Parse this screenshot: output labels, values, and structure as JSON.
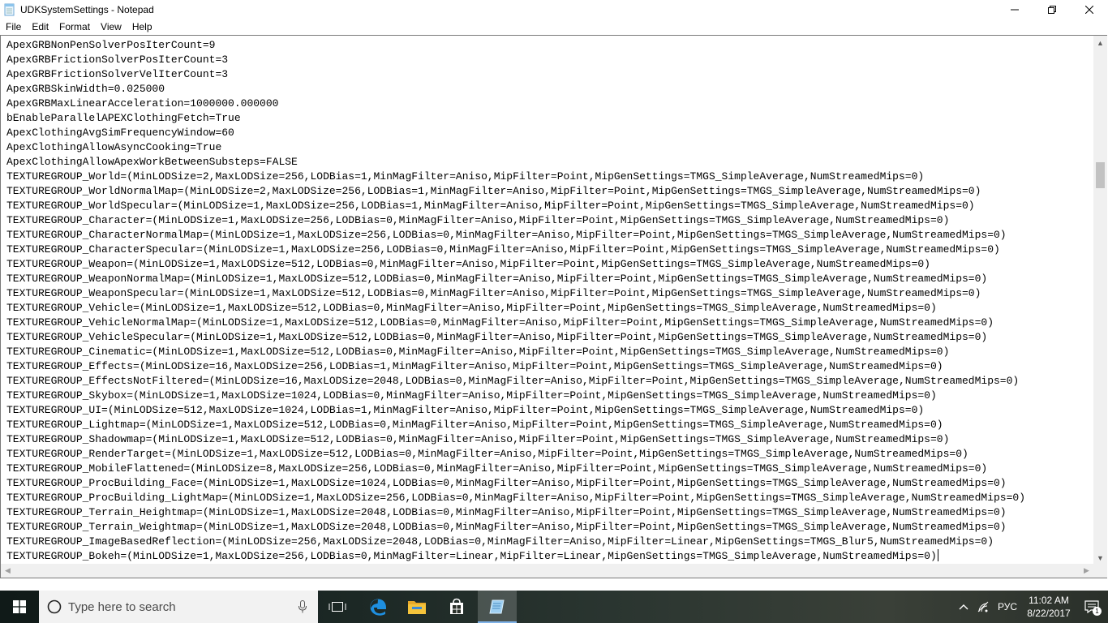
{
  "window": {
    "title": "UDKSystemSettings - Notepad"
  },
  "menu": [
    "File",
    "Edit",
    "Format",
    "View",
    "Help"
  ],
  "editor": {
    "lines": [
      "ApexGRBNonPenSolverPosIterCount=9",
      "ApexGRBFrictionSolverPosIterCount=3",
      "ApexGRBFrictionSolverVelIterCount=3",
      "ApexGRBSkinWidth=0.025000",
      "ApexGRBMaxLinearAcceleration=1000000.000000",
      "bEnableParallelAPEXClothingFetch=True",
      "ApexClothingAvgSimFrequencyWindow=60",
      "ApexClothingAllowAsyncCooking=True",
      "ApexClothingAllowApexWorkBetweenSubsteps=FALSE",
      "TEXTUREGROUP_World=(MinLODSize=2,MaxLODSize=256,LODBias=1,MinMagFilter=Aniso,MipFilter=Point,MipGenSettings=TMGS_SimpleAverage,NumStreamedMips=0)",
      "TEXTUREGROUP_WorldNormalMap=(MinLODSize=2,MaxLODSize=256,LODBias=1,MinMagFilter=Aniso,MipFilter=Point,MipGenSettings=TMGS_SimpleAverage,NumStreamedMips=0)",
      "TEXTUREGROUP_WorldSpecular=(MinLODSize=1,MaxLODSize=256,LODBias=1,MinMagFilter=Aniso,MipFilter=Point,MipGenSettings=TMGS_SimpleAverage,NumStreamedMips=0)",
      "TEXTUREGROUP_Character=(MinLODSize=1,MaxLODSize=256,LODBias=0,MinMagFilter=Aniso,MipFilter=Point,MipGenSettings=TMGS_SimpleAverage,NumStreamedMips=0)",
      "TEXTUREGROUP_CharacterNormalMap=(MinLODSize=1,MaxLODSize=256,LODBias=0,MinMagFilter=Aniso,MipFilter=Point,MipGenSettings=TMGS_SimpleAverage,NumStreamedMips=0)",
      "TEXTUREGROUP_CharacterSpecular=(MinLODSize=1,MaxLODSize=256,LODBias=0,MinMagFilter=Aniso,MipFilter=Point,MipGenSettings=TMGS_SimpleAverage,NumStreamedMips=0)",
      "TEXTUREGROUP_Weapon=(MinLODSize=1,MaxLODSize=512,LODBias=0,MinMagFilter=Aniso,MipFilter=Point,MipGenSettings=TMGS_SimpleAverage,NumStreamedMips=0)",
      "TEXTUREGROUP_WeaponNormalMap=(MinLODSize=1,MaxLODSize=512,LODBias=0,MinMagFilter=Aniso,MipFilter=Point,MipGenSettings=TMGS_SimpleAverage,NumStreamedMips=0)",
      "TEXTUREGROUP_WeaponSpecular=(MinLODSize=1,MaxLODSize=512,LODBias=0,MinMagFilter=Aniso,MipFilter=Point,MipGenSettings=TMGS_SimpleAverage,NumStreamedMips=0)",
      "TEXTUREGROUP_Vehicle=(MinLODSize=1,MaxLODSize=512,LODBias=0,MinMagFilter=Aniso,MipFilter=Point,MipGenSettings=TMGS_SimpleAverage,NumStreamedMips=0)",
      "TEXTUREGROUP_VehicleNormalMap=(MinLODSize=1,MaxLODSize=512,LODBias=0,MinMagFilter=Aniso,MipFilter=Point,MipGenSettings=TMGS_SimpleAverage,NumStreamedMips=0)",
      "TEXTUREGROUP_VehicleSpecular=(MinLODSize=1,MaxLODSize=512,LODBias=0,MinMagFilter=Aniso,MipFilter=Point,MipGenSettings=TMGS_SimpleAverage,NumStreamedMips=0)",
      "TEXTUREGROUP_Cinematic=(MinLODSize=1,MaxLODSize=512,LODBias=0,MinMagFilter=Aniso,MipFilter=Point,MipGenSettings=TMGS_SimpleAverage,NumStreamedMips=0)",
      "TEXTUREGROUP_Effects=(MinLODSize=16,MaxLODSize=256,LODBias=1,MinMagFilter=Aniso,MipFilter=Point,MipGenSettings=TMGS_SimpleAverage,NumStreamedMips=0)",
      "TEXTUREGROUP_EffectsNotFiltered=(MinLODSize=16,MaxLODSize=2048,LODBias=0,MinMagFilter=Aniso,MipFilter=Point,MipGenSettings=TMGS_SimpleAverage,NumStreamedMips=0)",
      "TEXTUREGROUP_Skybox=(MinLODSize=1,MaxLODSize=1024,LODBias=0,MinMagFilter=Aniso,MipFilter=Point,MipGenSettings=TMGS_SimpleAverage,NumStreamedMips=0)",
      "TEXTUREGROUP_UI=(MinLODSize=512,MaxLODSize=1024,LODBias=1,MinMagFilter=Aniso,MipFilter=Point,MipGenSettings=TMGS_SimpleAverage,NumStreamedMips=0)",
      "TEXTUREGROUP_Lightmap=(MinLODSize=1,MaxLODSize=512,LODBias=0,MinMagFilter=Aniso,MipFilter=Point,MipGenSettings=TMGS_SimpleAverage,NumStreamedMips=0)",
      "TEXTUREGROUP_Shadowmap=(MinLODSize=1,MaxLODSize=512,LODBias=0,MinMagFilter=Aniso,MipFilter=Point,MipGenSettings=TMGS_SimpleAverage,NumStreamedMips=0)",
      "TEXTUREGROUP_RenderTarget=(MinLODSize=1,MaxLODSize=512,LODBias=0,MinMagFilter=Aniso,MipFilter=Point,MipGenSettings=TMGS_SimpleAverage,NumStreamedMips=0)",
      "TEXTUREGROUP_MobileFlattened=(MinLODSize=8,MaxLODSize=256,LODBias=0,MinMagFilter=Aniso,MipFilter=Point,MipGenSettings=TMGS_SimpleAverage,NumStreamedMips=0)",
      "TEXTUREGROUP_ProcBuilding_Face=(MinLODSize=1,MaxLODSize=1024,LODBias=0,MinMagFilter=Aniso,MipFilter=Point,MipGenSettings=TMGS_SimpleAverage,NumStreamedMips=0)",
      "TEXTUREGROUP_ProcBuilding_LightMap=(MinLODSize=1,MaxLODSize=256,LODBias=0,MinMagFilter=Aniso,MipFilter=Point,MipGenSettings=TMGS_SimpleAverage,NumStreamedMips=0)",
      "TEXTUREGROUP_Terrain_Heightmap=(MinLODSize=1,MaxLODSize=2048,LODBias=0,MinMagFilter=Aniso,MipFilter=Point,MipGenSettings=TMGS_SimpleAverage,NumStreamedMips=0)",
      "TEXTUREGROUP_Terrain_Weightmap=(MinLODSize=1,MaxLODSize=2048,LODBias=0,MinMagFilter=Aniso,MipFilter=Point,MipGenSettings=TMGS_SimpleAverage,NumStreamedMips=0)",
      "TEXTUREGROUP_ImageBasedReflection=(MinLODSize=256,MaxLODSize=2048,LODBias=0,MinMagFilter=Aniso,MipFilter=Linear,MipGenSettings=TMGS_Blur5,NumStreamedMips=0)",
      "TEXTUREGROUP_Bokeh=(MinLODSize=1,MaxLODSize=256,LODBias=0,MinMagFilter=Linear,MipFilter=Linear,MipGenSettings=TMGS_SimpleAverage,NumStreamedMips=0)"
    ]
  },
  "taskbar": {
    "search_placeholder": "Type here to search",
    "apps": [
      {
        "icon": "task-view-icon"
      },
      {
        "icon": "edge-icon"
      },
      {
        "icon": "file-explorer-icon"
      },
      {
        "icon": "store-icon"
      },
      {
        "icon": "notepad-icon",
        "active": true
      }
    ],
    "language": "РУС",
    "time": "11:02 AM",
    "date": "8/22/2017",
    "notification_count": "1"
  },
  "colors": {
    "accent": "#7fb2e8",
    "edge_blue": "#1e8fe0",
    "explorer_yellow": "#f5c33b"
  }
}
